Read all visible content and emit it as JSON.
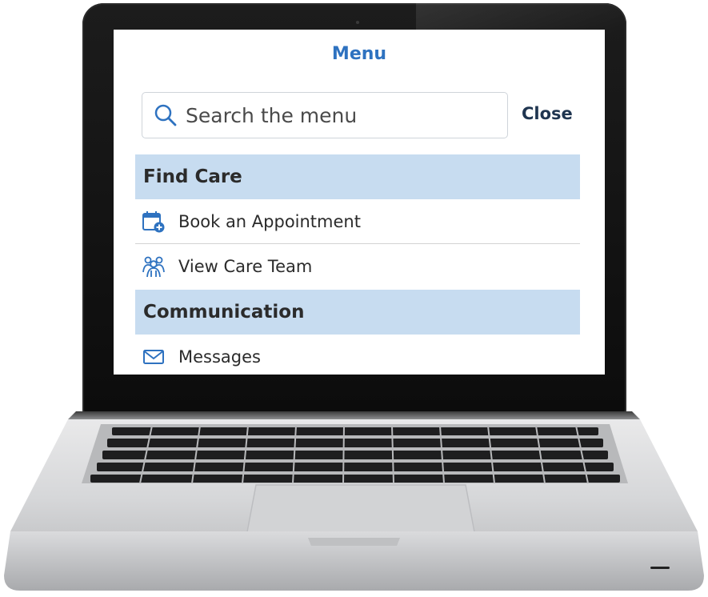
{
  "menu": {
    "title": "Menu",
    "search": {
      "placeholder": "Search the menu",
      "icon": "search-icon"
    },
    "close_label": "Close",
    "sections": [
      {
        "header": "Find Care",
        "items": [
          {
            "label": "Book an Appointment",
            "icon": "calendar-add-icon"
          },
          {
            "label": "View Care Team",
            "icon": "care-team-icon"
          }
        ]
      },
      {
        "header": "Communication",
        "items": [
          {
            "label": "Messages",
            "icon": "envelope-icon"
          }
        ]
      }
    ]
  },
  "colors": {
    "accent": "#2e72c0",
    "section_bg": "#c7dcf0",
    "close_text": "#1f3550",
    "text": "#2b2b2b"
  }
}
